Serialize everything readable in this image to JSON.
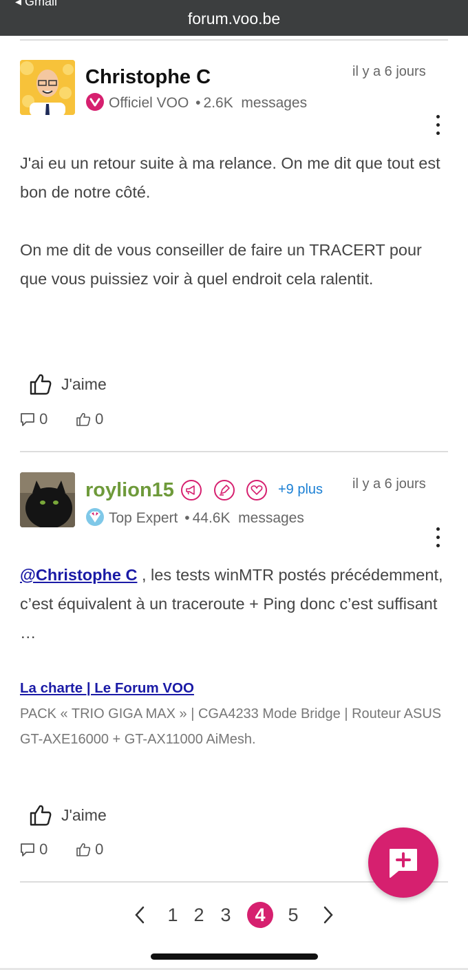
{
  "browser": {
    "back_label": "◂ Gmail",
    "url": "forum.voo.be"
  },
  "posts": [
    {
      "author": "Christophe C",
      "time": "il y a 6 jours",
      "role": "Officiel VOO",
      "message_count": "2.6K",
      "messages_label": "messages",
      "paragraphs": [
        "J'ai eu un retour suite à ma relance. On me dit que tout est bon de notre côté.",
        "On me dit de vous conseiller de faire un TRACERT pour que vous puissiez voir à quel endroit cela ralentit."
      ],
      "like_label": "J'aime",
      "replies": "0",
      "likes": "0"
    },
    {
      "author": "roylion15",
      "author_color": "#6e9a3a",
      "time": "il y a 6 jours",
      "more_badges": "+9 plus",
      "role": "Top Expert",
      "message_count": "44.6K",
      "messages_label": "messages",
      "mention": "@Christophe C",
      "mention_rest": " , les tests winMTR postés précédemment, c’est équivalent à un traceroute + Ping donc c’est suffisant …",
      "signature_link": "La charte | Le Forum VOO",
      "signature_text": "PACK « TRIO GIGA MAX » | CGA4233 Mode Bridge | Routeur ASUS GT-AXE16000 + GT-AX11000 AiMesh.",
      "like_label": "J'aime",
      "replies": "0",
      "likes": "0"
    }
  ],
  "pagination": {
    "pages": [
      "1",
      "2",
      "3",
      "4",
      "5"
    ],
    "current": "4"
  },
  "colors": {
    "accent": "#d6206f",
    "link": "#1a1aa6",
    "badge_blue": "#1a7fd4"
  },
  "icons": {
    "kebab": "more-vertical-icon",
    "like": "thumbs-up-icon",
    "reply": "comment-icon",
    "fab": "new-topic-plus-icon"
  }
}
